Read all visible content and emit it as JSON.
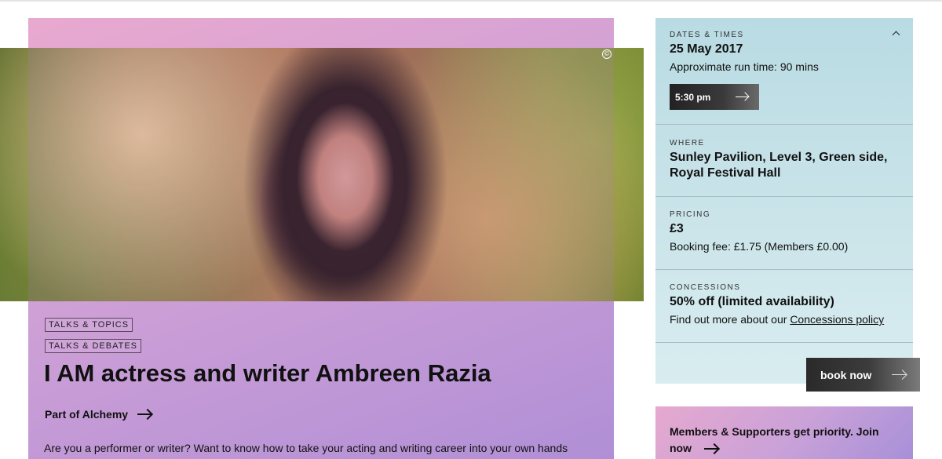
{
  "event": {
    "tags": [
      "TALKS & TOPICS",
      "TALKS & DEBATES"
    ],
    "title": "I AM actress and writer Ambreen Razia",
    "part_of": "Part of Alchemy",
    "intro": "Are you a performer or writer? Want to know how to take your acting and writing career into your own hands",
    "copyright_symbol": "©"
  },
  "info": {
    "dates": {
      "label": "DATES & TIMES",
      "date": "25 May 2017",
      "runtime": "Approximate run time: 90 mins",
      "time_button": "5:30 pm"
    },
    "where": {
      "label": "WHERE",
      "venue": "Sunley Pavilion, Level 3, Green side, Royal Festival Hall"
    },
    "pricing": {
      "label": "PRICING",
      "price": "£3",
      "fee": "Booking fee: £1.75 (Members £0.00)"
    },
    "concessions": {
      "label": "CONCESSIONS",
      "offer": "50% off (limited availability)",
      "more_prefix": "Find out more about our ",
      "policy_link": "Concessions policy"
    },
    "book_button": "book now"
  },
  "members": {
    "text": "Members & Supporters get priority. Join now"
  },
  "colors": {
    "event_card": "#cfa0d6",
    "info_panel": "#c4e0e7",
    "button_dark": "#2a2a2a"
  },
  "icons": {
    "collapse": "chevron-up-icon",
    "arrow": "arrow-right-icon",
    "copyright": "copyright-icon"
  }
}
